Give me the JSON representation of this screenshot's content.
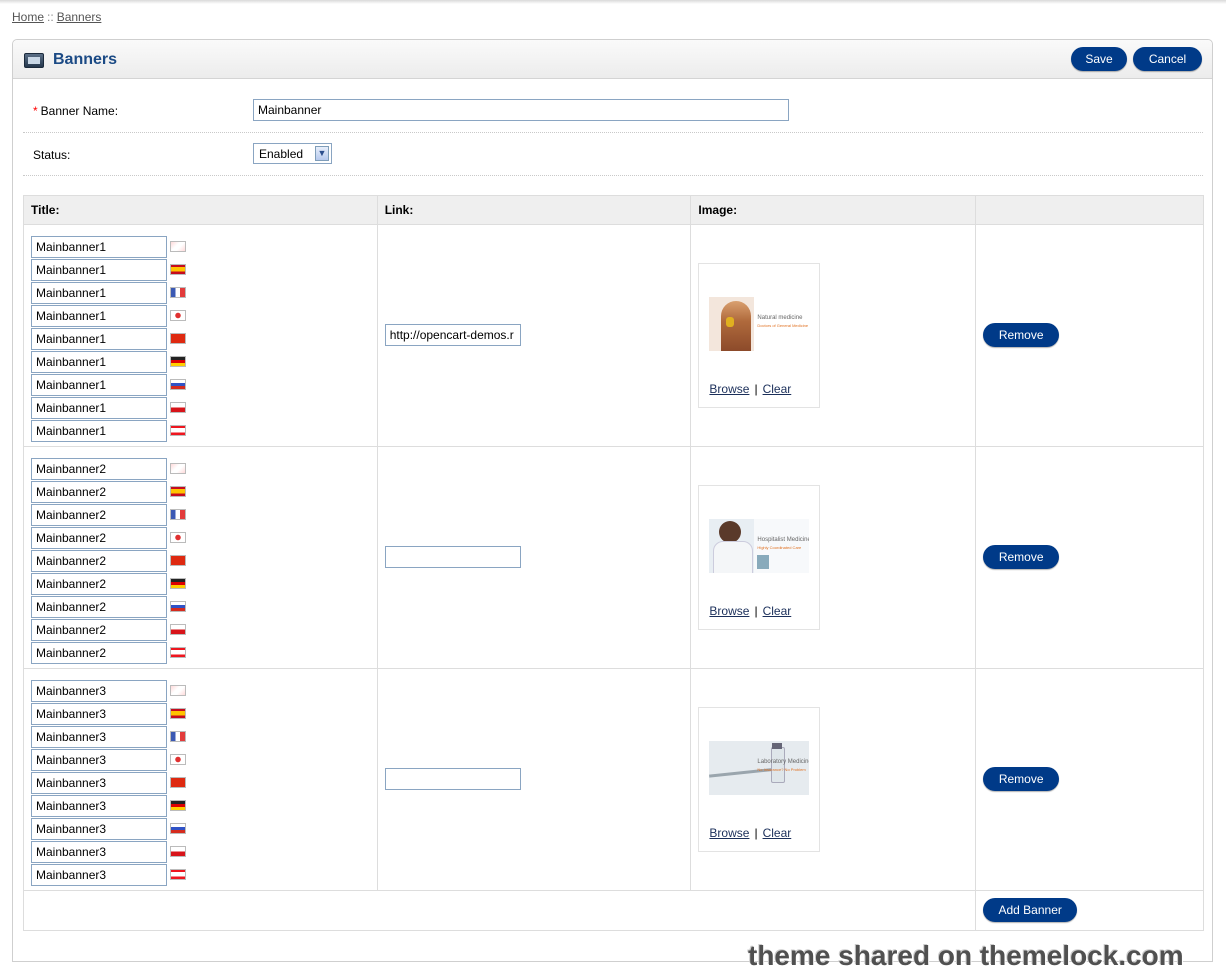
{
  "breadcrumb": {
    "home": "Home",
    "separator": "::",
    "current": "Banners"
  },
  "heading": {
    "title": "Banners",
    "icon": "banner-monitor-icon",
    "save": "Save",
    "cancel": "Cancel"
  },
  "form": {
    "name_label": "Banner Name:",
    "required_mark": "*",
    "name_value": "Mainbanner",
    "status_label": "Status:",
    "status_value": "Enabled"
  },
  "table": {
    "headers": {
      "title": "Title:",
      "link": "Link:",
      "image": "Image:"
    },
    "languages": [
      "english-flag",
      "spanish-flag",
      "french-flag",
      "japanese-flag",
      "chinese-flag",
      "german-flag",
      "russian-flag",
      "czech-flag",
      "lebanese-flag"
    ],
    "rows": [
      {
        "titles": [
          "Mainbanner1",
          "Mainbanner1",
          "Mainbanner1",
          "Mainbanner1",
          "Mainbanner1",
          "Mainbanner1",
          "Mainbanner1",
          "Mainbanner1",
          "Mainbanner1"
        ],
        "link": "http://opencart-demos.r",
        "image_text": [
          "Natural medicine",
          "Doctors of General Medicine"
        ],
        "browse": "Browse",
        "clear": "Clear",
        "remove": "Remove"
      },
      {
        "titles": [
          "Mainbanner2",
          "Mainbanner2",
          "Mainbanner2",
          "Mainbanner2",
          "Mainbanner2",
          "Mainbanner2",
          "Mainbanner2",
          "Mainbanner2",
          "Mainbanner2"
        ],
        "link": "",
        "image_text": [
          "Hospitalist Medicine",
          "Highly Coordinated Care"
        ],
        "browse": "Browse",
        "clear": "Clear",
        "remove": "Remove"
      },
      {
        "titles": [
          "Mainbanner3",
          "Mainbanner3",
          "Mainbanner3",
          "Mainbanner3",
          "Mainbanner3",
          "Mainbanner3",
          "Mainbanner3",
          "Mainbanner3",
          "Mainbanner3"
        ],
        "link": "",
        "image_text": [
          "Laboratory Medicine",
          "No Insurance? No Problem"
        ],
        "browse": "Browse",
        "clear": "Clear",
        "remove": "Remove"
      }
    ],
    "add_banner": "Add Banner"
  },
  "watermark": "theme shared on themelock.com",
  "colors": {
    "button": "#003a88",
    "heading_title": "#1b4a85",
    "input_border": "#8aa5c2"
  }
}
